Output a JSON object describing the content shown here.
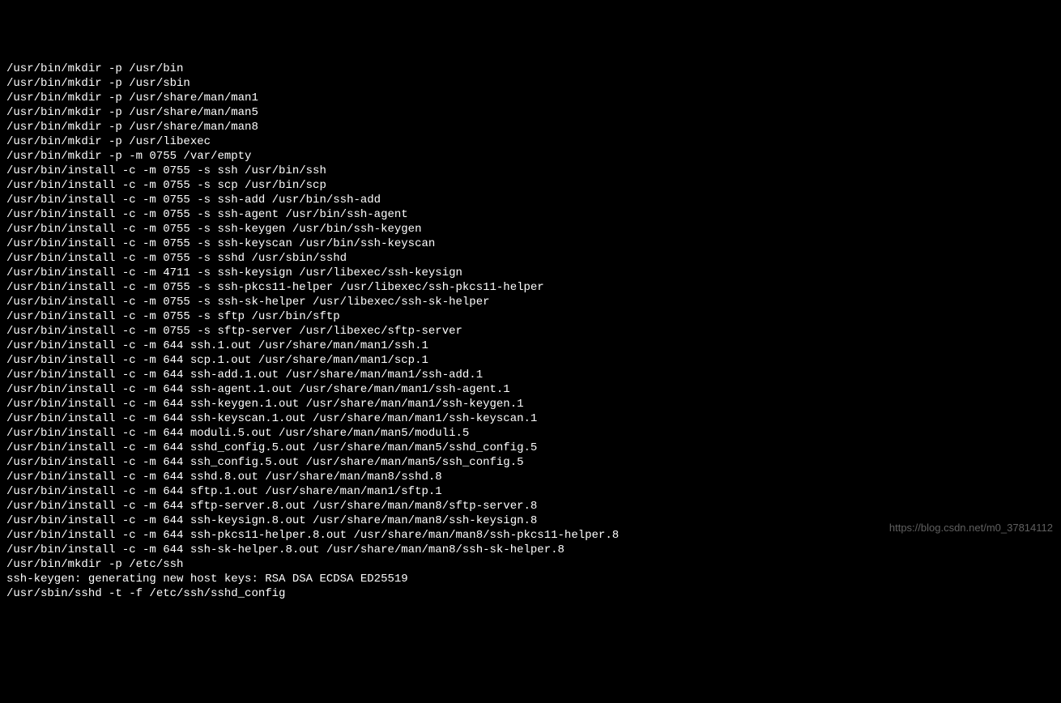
{
  "terminal": {
    "lines": [
      "/usr/bin/mkdir -p /usr/bin",
      "/usr/bin/mkdir -p /usr/sbin",
      "/usr/bin/mkdir -p /usr/share/man/man1",
      "/usr/bin/mkdir -p /usr/share/man/man5",
      "/usr/bin/mkdir -p /usr/share/man/man8",
      "/usr/bin/mkdir -p /usr/libexec",
      "/usr/bin/mkdir -p -m 0755 /var/empty",
      "/usr/bin/install -c -m 0755 -s ssh /usr/bin/ssh",
      "/usr/bin/install -c -m 0755 -s scp /usr/bin/scp",
      "/usr/bin/install -c -m 0755 -s ssh-add /usr/bin/ssh-add",
      "/usr/bin/install -c -m 0755 -s ssh-agent /usr/bin/ssh-agent",
      "/usr/bin/install -c -m 0755 -s ssh-keygen /usr/bin/ssh-keygen",
      "/usr/bin/install -c -m 0755 -s ssh-keyscan /usr/bin/ssh-keyscan",
      "/usr/bin/install -c -m 0755 -s sshd /usr/sbin/sshd",
      "/usr/bin/install -c -m 4711 -s ssh-keysign /usr/libexec/ssh-keysign",
      "/usr/bin/install -c -m 0755 -s ssh-pkcs11-helper /usr/libexec/ssh-pkcs11-helper",
      "/usr/bin/install -c -m 0755 -s ssh-sk-helper /usr/libexec/ssh-sk-helper",
      "/usr/bin/install -c -m 0755 -s sftp /usr/bin/sftp",
      "/usr/bin/install -c -m 0755 -s sftp-server /usr/libexec/sftp-server",
      "/usr/bin/install -c -m 644 ssh.1.out /usr/share/man/man1/ssh.1",
      "/usr/bin/install -c -m 644 scp.1.out /usr/share/man/man1/scp.1",
      "/usr/bin/install -c -m 644 ssh-add.1.out /usr/share/man/man1/ssh-add.1",
      "/usr/bin/install -c -m 644 ssh-agent.1.out /usr/share/man/man1/ssh-agent.1",
      "/usr/bin/install -c -m 644 ssh-keygen.1.out /usr/share/man/man1/ssh-keygen.1",
      "/usr/bin/install -c -m 644 ssh-keyscan.1.out /usr/share/man/man1/ssh-keyscan.1",
      "/usr/bin/install -c -m 644 moduli.5.out /usr/share/man/man5/moduli.5",
      "/usr/bin/install -c -m 644 sshd_config.5.out /usr/share/man/man5/sshd_config.5",
      "/usr/bin/install -c -m 644 ssh_config.5.out /usr/share/man/man5/ssh_config.5",
      "/usr/bin/install -c -m 644 sshd.8.out /usr/share/man/man8/sshd.8",
      "/usr/bin/install -c -m 644 sftp.1.out /usr/share/man/man1/sftp.1",
      "/usr/bin/install -c -m 644 sftp-server.8.out /usr/share/man/man8/sftp-server.8",
      "/usr/bin/install -c -m 644 ssh-keysign.8.out /usr/share/man/man8/ssh-keysign.8",
      "/usr/bin/install -c -m 644 ssh-pkcs11-helper.8.out /usr/share/man/man8/ssh-pkcs11-helper.8",
      "/usr/bin/install -c -m 644 ssh-sk-helper.8.out /usr/share/man/man8/ssh-sk-helper.8",
      "/usr/bin/mkdir -p /etc/ssh",
      "ssh-keygen: generating new host keys: RSA DSA ECDSA ED25519",
      "/usr/sbin/sshd -t -f /etc/ssh/sshd_config"
    ]
  },
  "watermark": "https://blog.csdn.net/m0_37814112"
}
